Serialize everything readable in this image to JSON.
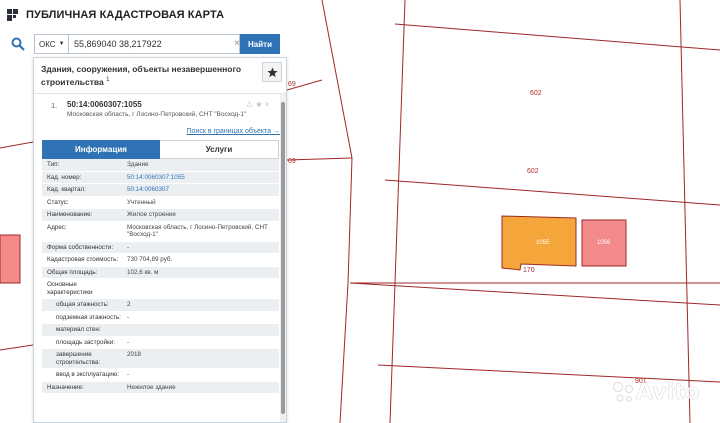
{
  "app": {
    "title": "ПУБЛИЧНАЯ КАДАСТРОВАЯ КАРТА"
  },
  "search": {
    "layer": "ОКС",
    "query": "55,869040 38,217922",
    "find_label": "Найти"
  },
  "panel": {
    "title": "Здания, сооружения, объекты незавершенного строительства",
    "count": "1",
    "result_number": "1.",
    "cadastral_id": "50:14:0060307:1055",
    "address_short": "Московская область, г Лосино-Петровский, СНТ \"Восход-1\"",
    "search_in_bounds": "Поиск в границах объекта →",
    "tabs": [
      "Информация",
      "Услуги"
    ],
    "rows": [
      {
        "label": "Тип:",
        "value": "Здание",
        "shade": true
      },
      {
        "label": "Кад. номер:",
        "value": "50:14:0060307:1055",
        "shade": true,
        "link": true
      },
      {
        "label": "Кад. квартал:",
        "value": "50:14:0060307",
        "shade": true,
        "link": true
      },
      {
        "label": "Статус:",
        "value": "Учтенный",
        "shade": false
      },
      {
        "label": "Наименование:",
        "value": "Жилое строение",
        "shade": true
      },
      {
        "label": "Адрес:",
        "value": "Московская область, г Лосино-Петровский, СНТ \"Восход-1\"",
        "shade": false
      },
      {
        "label": "Форма собственности:",
        "value": "-",
        "shade": true
      },
      {
        "label": "Кадастровая стоимость:",
        "value": "730 704,89 руб.",
        "shade": false
      },
      {
        "label": "Общая площадь:",
        "value": "102,6 кв. м",
        "shade": true
      },
      {
        "label": "Основные характеристики",
        "value": "",
        "shade": false
      },
      {
        "label": "общая этажность:",
        "value": "2",
        "shade": true,
        "sub": true
      },
      {
        "label": "подземная этажность:",
        "value": "-",
        "shade": false,
        "sub": true
      },
      {
        "label": "материал стен:",
        "value": "",
        "shade": true,
        "sub": true
      },
      {
        "label": "площадь застройки:",
        "value": "-",
        "shade": false,
        "sub": true
      },
      {
        "label": "завершение строительства:",
        "value": "2018",
        "shade": true,
        "sub": true
      },
      {
        "label": "ввод в эксплуатацию:",
        "value": "-",
        "shade": false,
        "sub": true
      },
      {
        "label": "Назначение:",
        "value": "Нежилое здание",
        "shade": true
      }
    ]
  },
  "map": {
    "labels": {
      "l602a": "602",
      "l602b": "602",
      "l170": "170",
      "l901": "901",
      "l69a": "69",
      "l69b": "69",
      "bld1": "1055",
      "bld2": "1056"
    },
    "colors": {
      "lines": "#a02828",
      "building_orange": "#f5a63a",
      "building_red": "#f48a8a"
    }
  },
  "watermark": {
    "text": "Avito"
  }
}
